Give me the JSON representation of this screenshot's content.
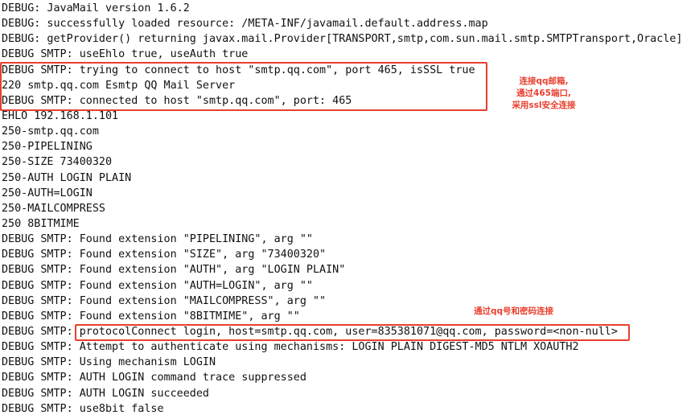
{
  "log": {
    "lines": [
      "DEBUG: JavaMail version 1.6.2",
      "DEBUG: successfully loaded resource: /META-INF/javamail.default.address.map",
      "DEBUG: getProvider() returning javax.mail.Provider[TRANSPORT,smtp,com.sun.mail.smtp.SMTPTransport,Oracle]",
      "DEBUG SMTP: useEhlo true, useAuth true",
      "DEBUG SMTP: trying to connect to host \"smtp.qq.com\", port 465, isSSL true",
      "220 smtp.qq.com Esmtp QQ Mail Server",
      "DEBUG SMTP: connected to host \"smtp.qq.com\", port: 465",
      "EHLO 192.168.1.101",
      "250-smtp.qq.com",
      "250-PIPELINING",
      "250-SIZE 73400320",
      "250-AUTH LOGIN PLAIN",
      "250-AUTH=LOGIN",
      "250-MAILCOMPRESS",
      "250 8BITMIME",
      "DEBUG SMTP: Found extension \"PIPELINING\", arg \"\"",
      "DEBUG SMTP: Found extension \"SIZE\", arg \"73400320\"",
      "DEBUG SMTP: Found extension \"AUTH\", arg \"LOGIN PLAIN\"",
      "DEBUG SMTP: Found extension \"AUTH=LOGIN\", arg \"\"",
      "DEBUG SMTP: Found extension \"MAILCOMPRESS\", arg \"\"",
      "DEBUG SMTP: Found extension \"8BITMIME\", arg \"\"",
      "DEBUG SMTP: protocolConnect login, host=smtp.qq.com, user=835381071@qq.com, password=<non-null>",
      "DEBUG SMTP: Attempt to authenticate using mechanisms: LOGIN PLAIN DIGEST-MD5 NTLM XOAUTH2",
      "DEBUG SMTP: Using mechanism LOGIN",
      "DEBUG SMTP: AUTH LOGIN command trace suppressed",
      "DEBUG SMTP: AUTH LOGIN succeeded",
      "DEBUG SMTP: use8bit false"
    ]
  },
  "annotations": {
    "ssl_note": {
      "line1": "连接qq邮箱,",
      "line2": "通过465端口,",
      "line3": "采用ssl安全连接"
    },
    "login_note": {
      "text": "通过qq号和密码连接"
    },
    "color": "#e8402f"
  }
}
